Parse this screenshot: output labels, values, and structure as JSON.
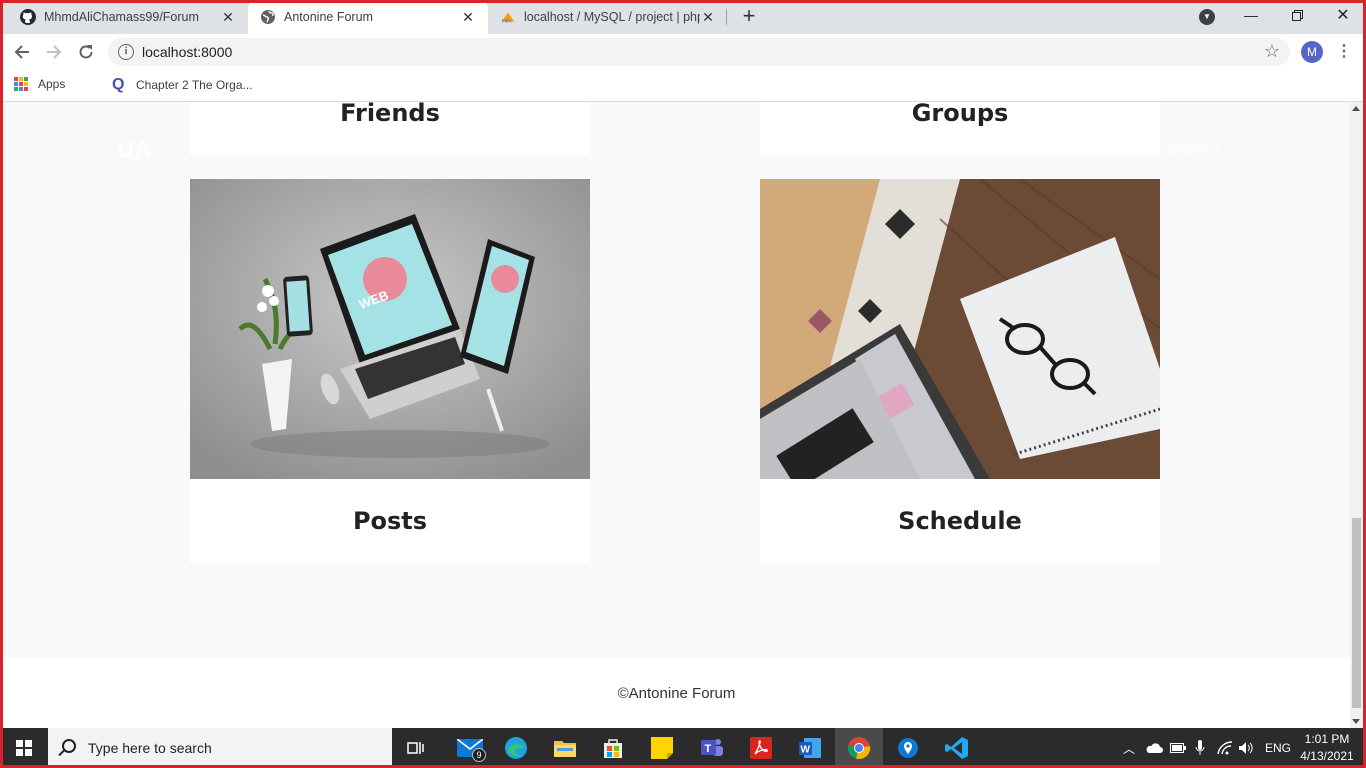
{
  "browser": {
    "tabs": [
      {
        "title": "MhmdAliChamass99/Forum",
        "icon": "github-icon",
        "active": false
      },
      {
        "title": "Antonine Forum",
        "icon": "globe-icon",
        "active": true
      },
      {
        "title": "localhost / MySQL / project | php",
        "icon": "phpmyadmin-icon",
        "active": false
      }
    ],
    "url": "localhost:8000",
    "profile_initial": "M",
    "bookmarks": [
      {
        "label": "Apps",
        "icon": "apps-grid-icon"
      },
      {
        "label": "Chapter 2 The Orga...",
        "icon": "quizlet-icon"
      }
    ]
  },
  "page": {
    "ghost_logo": "UA",
    "ghost_nav": "WORKS",
    "cards_top": [
      {
        "title": "Friends"
      },
      {
        "title": "Groups"
      }
    ],
    "cards": [
      {
        "title": "Posts",
        "image": "floating-devices-image"
      },
      {
        "title": "Schedule",
        "image": "laptop-notebook-desk-image"
      }
    ],
    "footer": "©Antonine Forum"
  },
  "taskbar": {
    "search_placeholder": "Type here to search",
    "mail_badge": "9",
    "language": "ENG",
    "time": "1:01 PM",
    "date": "4/13/2021",
    "apps": [
      "task-view-icon",
      "mail-icon",
      "edge-icon",
      "file-explorer-icon",
      "store-icon",
      "sticky-notes-icon",
      "teams-icon",
      "acrobat-icon",
      "word-icon",
      "chrome-icon",
      "maps-icon",
      "vscode-icon"
    ]
  }
}
